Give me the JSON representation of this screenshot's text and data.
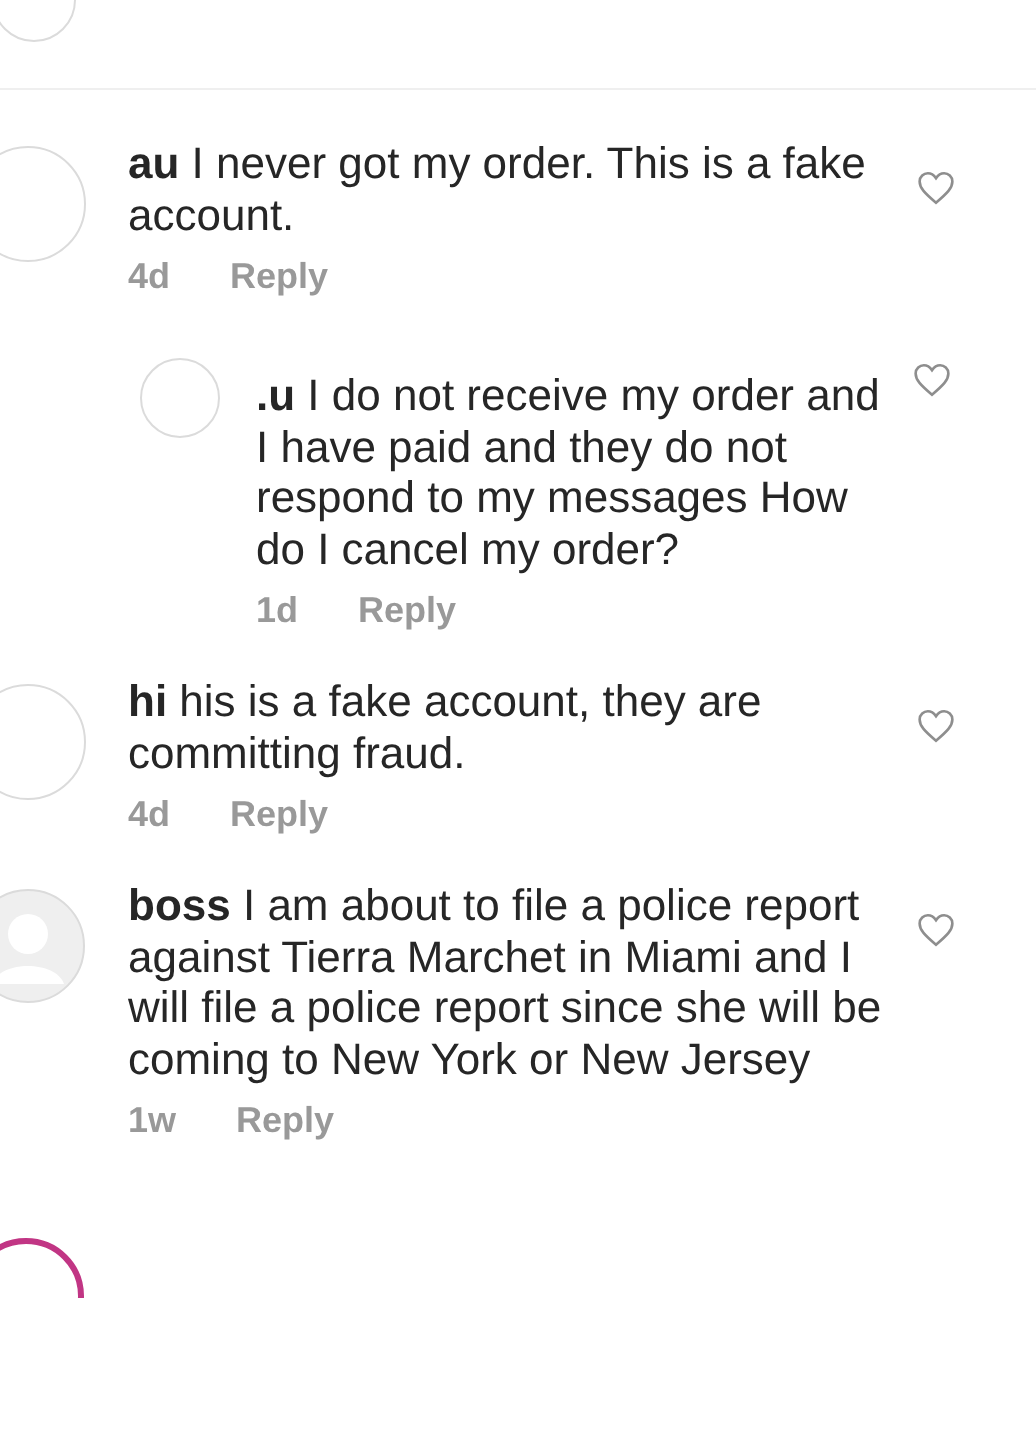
{
  "comments": [
    {
      "username": "au",
      "text": "I never got my order. This is a fake account.",
      "time": "4d",
      "reply_label": "Reply",
      "is_reply": false,
      "kind": "empty",
      "liked": false
    },
    {
      "username": ".u",
      "text": "I do not receive my order and I have paid and they do not respond to my messages How do I cancel my order?",
      "time": "1d",
      "reply_label": "Reply",
      "is_reply": true,
      "kind": "empty",
      "liked": false
    },
    {
      "username": "hi",
      "text": "his is a fake account, they are committing fraud.",
      "time": "4d",
      "reply_label": "Reply",
      "is_reply": false,
      "kind": "empty",
      "liked": false
    },
    {
      "username": "boss",
      "text": "I am about to file a police report against Tierra Marchet in Miami and I will file a police report since she will be coming to New York or New Jersey",
      "time": "1w",
      "reply_label": "Reply",
      "is_reply": false,
      "kind": "silhouette",
      "liked": false
    }
  ]
}
